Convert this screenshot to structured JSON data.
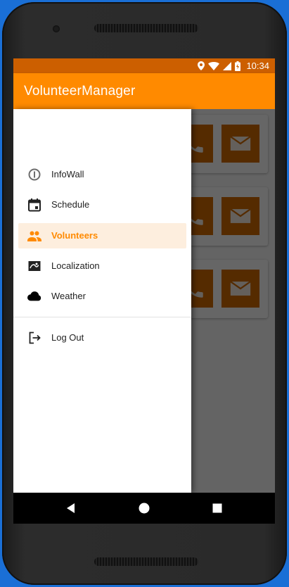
{
  "status_bar": {
    "time": "10:34",
    "icons": [
      "location-icon",
      "wifi-icon",
      "signal-icon",
      "battery-icon"
    ]
  },
  "app_bar": {
    "title": "VolunteerManager"
  },
  "drawer": {
    "items": [
      {
        "label": "InfoWall",
        "icon": "info-icon",
        "active": false
      },
      {
        "label": "Schedule",
        "icon": "calendar-icon",
        "active": false
      },
      {
        "label": "Volunteers",
        "icon": "people-icon",
        "active": true
      },
      {
        "label": "Localization",
        "icon": "map-icon",
        "active": false
      },
      {
        "label": "Weather",
        "icon": "cloud-icon",
        "active": false
      }
    ],
    "logout": {
      "label": "Log Out",
      "icon": "logout-icon"
    }
  },
  "cards": {
    "count": 3,
    "buttons": [
      "phone-icon",
      "mail-icon"
    ]
  },
  "colors": {
    "status_bar": "#cc5f00",
    "app_bar": "#ff8a00",
    "accent": "#ff8a00",
    "active_bg": "#fdeede",
    "card_button": "#d46c00"
  },
  "nav_bar": {
    "buttons": [
      "back-icon",
      "home-icon",
      "recents-icon"
    ]
  }
}
